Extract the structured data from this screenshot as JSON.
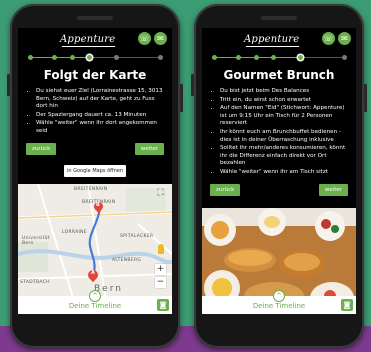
{
  "brand": {
    "logo_text": "Appenture"
  },
  "screens": [
    {
      "title": "Folgt der Karte",
      "bullets": [
        "Du siehst euer Ziel (Lorrainestrasse 15, 3013 Bern, Schweiz) auf der Karte, geht zu Fuss dort hin",
        "Der Spaziergang dauert ca. 13 Minuten",
        "Wähle \"weiter\" wenn ihr dort angekommen seid"
      ],
      "back_label": "zurück",
      "next_label": "weiter",
      "maps_button_label": "in Google Maps öffnen",
      "map_labels": {
        "breitenrain_1": "BREITENRAIN",
        "breitenrain_2": "BREITENRAIN",
        "lorraine": "LORRAINE",
        "spitalacker": "SPITALACKER",
        "universitat": "Universität Bern",
        "altenberg": "ALTENBERG",
        "stadtbach": "STADTBACH",
        "bern": "Bern",
        "marker_b": "B",
        "marker_a": "A"
      },
      "timeline_label": "Deine Timeline",
      "progress_done": 3,
      "progress_total": 6
    },
    {
      "title": "Gourmet Brunch",
      "bullets": [
        "Du bist jetzt beim Des Balances",
        "Tritt ein, du wirst schon erwartet",
        "Auf den Namen \"Eid\" (Stichwort: Appenture) ist um 9:15 Uhr ein Tisch für 2 Personen reserviert",
        "Ihr könnt euch am Brunchbuffet bedienen - dies ist in deiner Überraschung inklusive",
        "Solltet ihr mehr/anderes konsumieren, könnt ihr die Differenz einfach direkt vor Ort bezahlen",
        "Wähle \"weiter\" wenn ihr am Tisch sitzt"
      ],
      "back_label": "zurück",
      "next_label": "weiter",
      "timeline_label": "Deine Timeline",
      "progress_done": 4,
      "progress_total": 6
    }
  ],
  "icons": {
    "phone": "☏",
    "chat": "✉",
    "chevron": "^",
    "camera": "◙",
    "fullscreen": "⛶",
    "zoom_in": "+",
    "zoom_out": "−"
  },
  "colors": {
    "background": "#3c9c74",
    "accent_green": "#6ab04c",
    "screen_bg": "#000000",
    "band": "#7d3a8e"
  }
}
